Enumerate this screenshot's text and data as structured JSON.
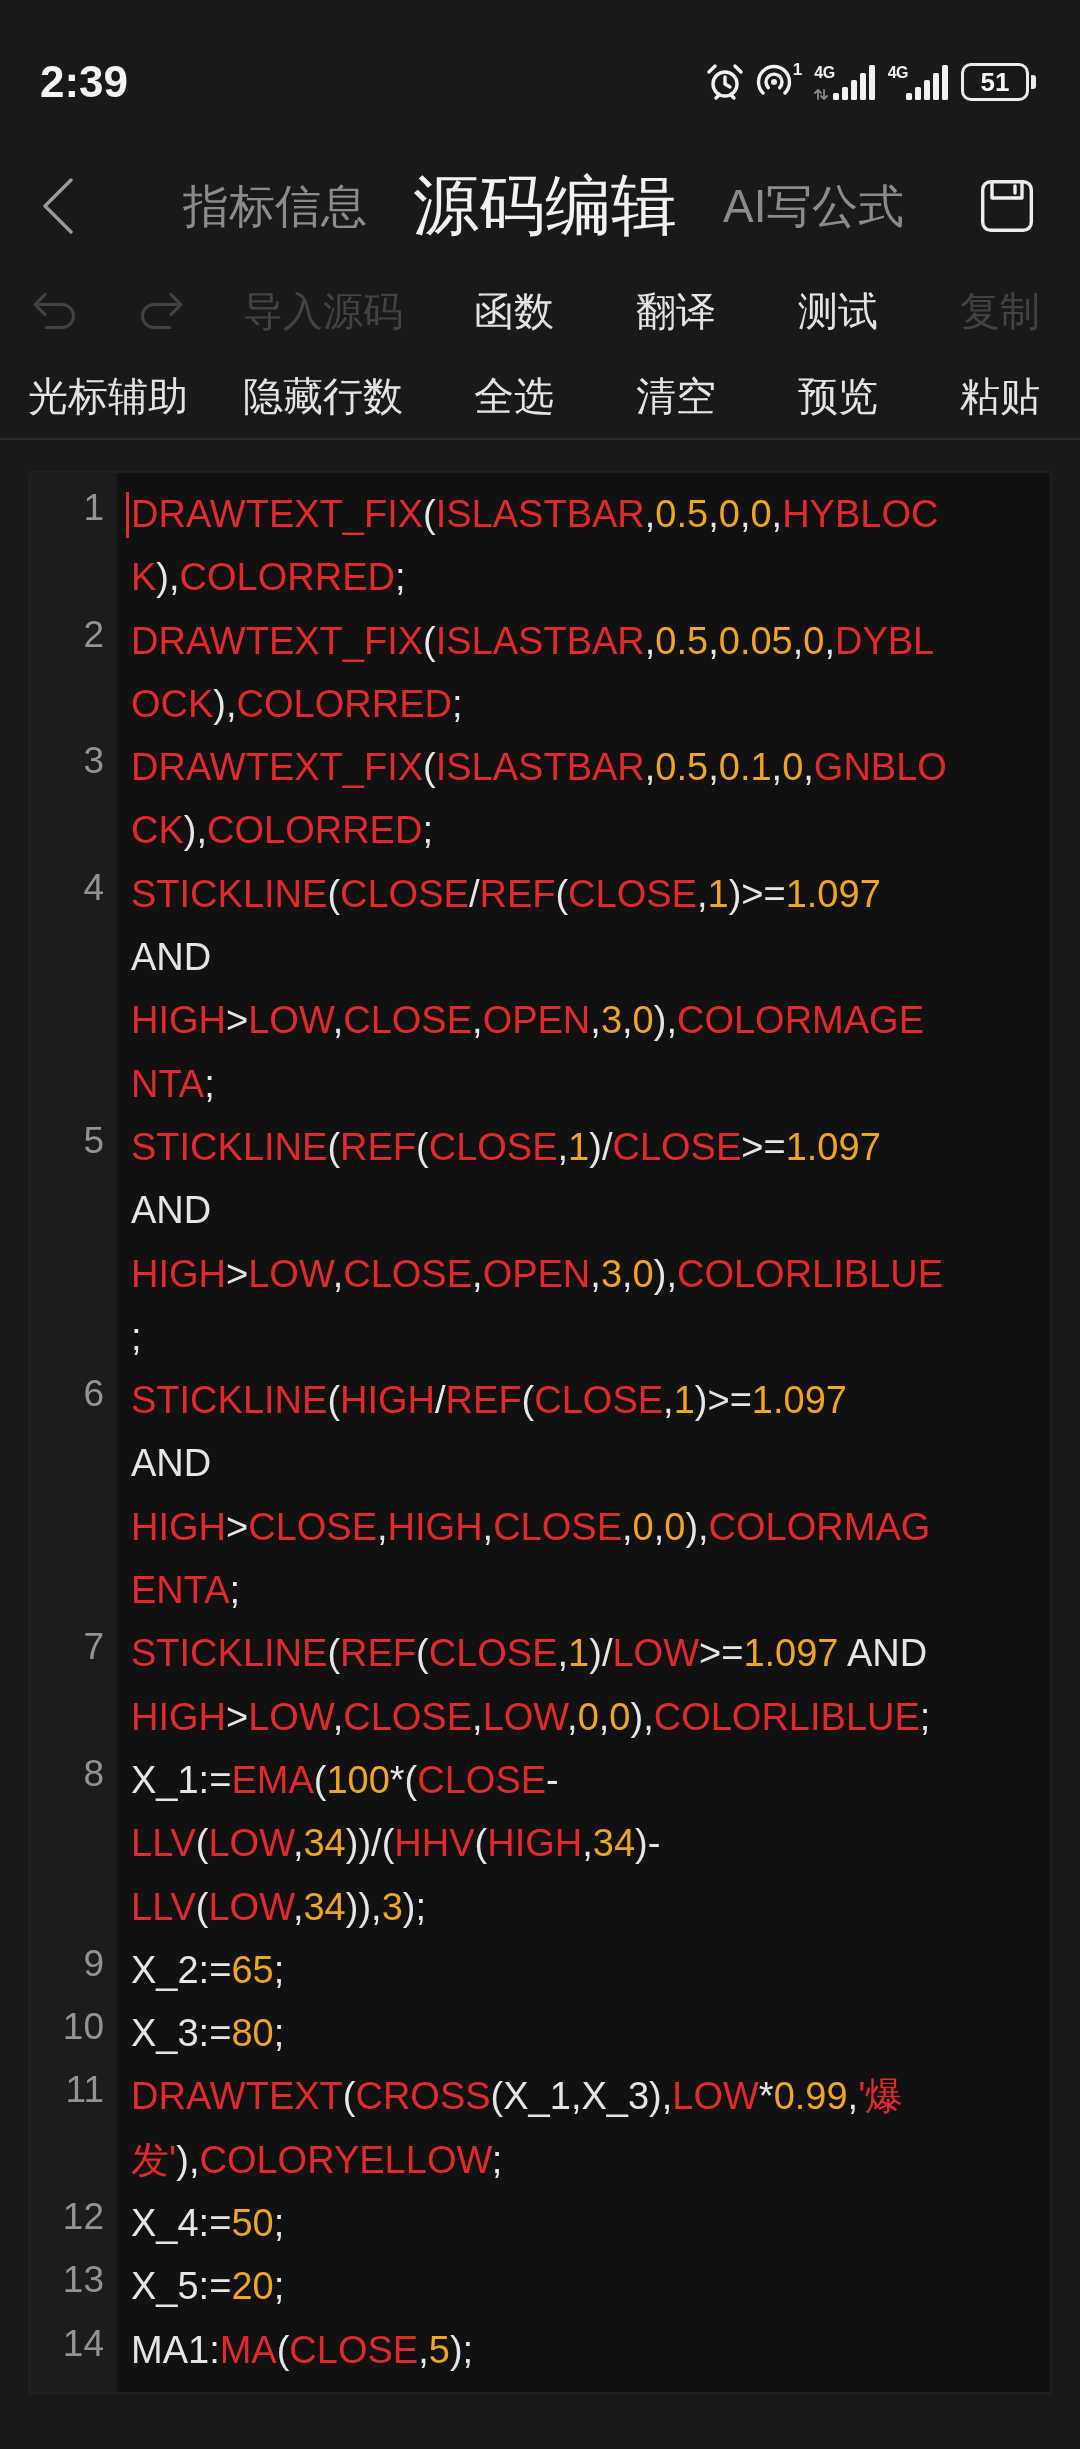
{
  "status_bar": {
    "time": "2:39",
    "hotspot_count": "1",
    "signals": [
      {
        "label": "4G",
        "data_activity": true
      },
      {
        "label": "4G",
        "data_activity": false
      }
    ],
    "battery": "51"
  },
  "header": {
    "tabs": [
      {
        "label": "指标信息",
        "selected": false
      },
      {
        "label": "源码编辑",
        "selected": true
      },
      {
        "label": "AI写公式",
        "selected": false
      }
    ]
  },
  "toolbar": {
    "rows": [
      {
        "items": [
          {
            "kind": "undo",
            "disabled": true
          },
          {
            "kind": "redo",
            "disabled": true
          },
          {
            "kind": "text",
            "label": "导入源码",
            "disabled": true
          },
          {
            "kind": "text",
            "label": "函数",
            "disabled": false
          },
          {
            "kind": "text",
            "label": "翻译",
            "disabled": false
          },
          {
            "kind": "text",
            "label": "测试",
            "disabled": false
          },
          {
            "kind": "text",
            "label": "复制",
            "disabled": true
          }
        ]
      },
      {
        "items": [
          {
            "kind": "text",
            "label": "光标辅助",
            "disabled": false
          },
          {
            "kind": "text",
            "label": "隐藏行数",
            "disabled": false
          },
          {
            "kind": "text",
            "label": "全选",
            "disabled": false
          },
          {
            "kind": "text",
            "label": "清空",
            "disabled": false
          },
          {
            "kind": "text",
            "label": "预览",
            "disabled": false
          },
          {
            "kind": "text",
            "label": "粘贴",
            "disabled": false
          }
        ]
      }
    ]
  },
  "editor": {
    "lines": [
      {
        "number": "1",
        "cursor": true,
        "wrapped_rows": [
          {
            "tokens": [
              {
                "kind": "keyword",
                "text": "DRAWTEXT_FIX"
              },
              {
                "kind": "plain",
                "text": "("
              },
              {
                "kind": "keyword",
                "text": "ISLASTBAR"
              },
              {
                "kind": "plain",
                "text": ","
              },
              {
                "kind": "number",
                "text": "0.5"
              },
              {
                "kind": "plain",
                "text": ","
              },
              {
                "kind": "number",
                "text": "0"
              },
              {
                "kind": "plain",
                "text": ","
              },
              {
                "kind": "number",
                "text": "0"
              },
              {
                "kind": "plain",
                "text": ","
              },
              {
                "kind": "keyword",
                "text": "HYBLOC"
              }
            ]
          },
          {
            "tokens": [
              {
                "kind": "keyword",
                "text": "K"
              },
              {
                "kind": "plain",
                "text": "),"
              },
              {
                "kind": "keyword",
                "text": "COLORRED"
              },
              {
                "kind": "plain",
                "text": ";"
              }
            ]
          }
        ]
      },
      {
        "number": "2",
        "cursor": false,
        "wrapped_rows": [
          {
            "tokens": [
              {
                "kind": "keyword",
                "text": "DRAWTEXT_FIX"
              },
              {
                "kind": "plain",
                "text": "("
              },
              {
                "kind": "keyword",
                "text": "ISLASTBAR"
              },
              {
                "kind": "plain",
                "text": ","
              },
              {
                "kind": "number",
                "text": "0.5"
              },
              {
                "kind": "plain",
                "text": ","
              },
              {
                "kind": "number",
                "text": "0.05"
              },
              {
                "kind": "plain",
                "text": ","
              },
              {
                "kind": "number",
                "text": "0"
              },
              {
                "kind": "plain",
                "text": ","
              },
              {
                "kind": "keyword",
                "text": "DYBL"
              }
            ]
          },
          {
            "tokens": [
              {
                "kind": "keyword",
                "text": "OCK"
              },
              {
                "kind": "plain",
                "text": "),"
              },
              {
                "kind": "keyword",
                "text": "COLORRED"
              },
              {
                "kind": "plain",
                "text": ";"
              }
            ]
          }
        ]
      },
      {
        "number": "3",
        "cursor": false,
        "wrapped_rows": [
          {
            "tokens": [
              {
                "kind": "keyword",
                "text": "DRAWTEXT_FIX"
              },
              {
                "kind": "plain",
                "text": "("
              },
              {
                "kind": "keyword",
                "text": "ISLASTBAR"
              },
              {
                "kind": "plain",
                "text": ","
              },
              {
                "kind": "number",
                "text": "0.5"
              },
              {
                "kind": "plain",
                "text": ","
              },
              {
                "kind": "number",
                "text": "0.1"
              },
              {
                "kind": "plain",
                "text": ","
              },
              {
                "kind": "number",
                "text": "0"
              },
              {
                "kind": "plain",
                "text": ","
              },
              {
                "kind": "keyword",
                "text": "GNBLO"
              }
            ]
          },
          {
            "tokens": [
              {
                "kind": "keyword",
                "text": "CK"
              },
              {
                "kind": "plain",
                "text": "),"
              },
              {
                "kind": "keyword",
                "text": "COLORRED"
              },
              {
                "kind": "plain",
                "text": ";"
              }
            ]
          }
        ]
      },
      {
        "number": "4",
        "cursor": false,
        "wrapped_rows": [
          {
            "tokens": [
              {
                "kind": "keyword",
                "text": "STICKLINE"
              },
              {
                "kind": "plain",
                "text": "("
              },
              {
                "kind": "keyword",
                "text": "CLOSE"
              },
              {
                "kind": "plain",
                "text": "/"
              },
              {
                "kind": "keyword",
                "text": "REF"
              },
              {
                "kind": "plain",
                "text": "("
              },
              {
                "kind": "keyword",
                "text": "CLOSE"
              },
              {
                "kind": "plain",
                "text": ","
              },
              {
                "kind": "number",
                "text": "1"
              },
              {
                "kind": "plain",
                "text": ")>="
              },
              {
                "kind": "number",
                "text": "1.097"
              }
            ]
          },
          {
            "tokens": [
              {
                "kind": "plain",
                "text": "AND"
              }
            ]
          },
          {
            "tokens": [
              {
                "kind": "keyword",
                "text": "HIGH"
              },
              {
                "kind": "plain",
                "text": ">"
              },
              {
                "kind": "keyword",
                "text": "LOW"
              },
              {
                "kind": "plain",
                "text": ","
              },
              {
                "kind": "keyword",
                "text": "CLOSE"
              },
              {
                "kind": "plain",
                "text": ","
              },
              {
                "kind": "keyword",
                "text": "OPEN"
              },
              {
                "kind": "plain",
                "text": ","
              },
              {
                "kind": "number",
                "text": "3"
              },
              {
                "kind": "plain",
                "text": ","
              },
              {
                "kind": "number",
                "text": "0"
              },
              {
                "kind": "plain",
                "text": "),"
              },
              {
                "kind": "keyword",
                "text": "COLORMAGE"
              }
            ]
          },
          {
            "tokens": [
              {
                "kind": "keyword",
                "text": "NTA"
              },
              {
                "kind": "plain",
                "text": ";"
              }
            ]
          }
        ]
      },
      {
        "number": "5",
        "cursor": false,
        "wrapped_rows": [
          {
            "tokens": [
              {
                "kind": "keyword",
                "text": "STICKLINE"
              },
              {
                "kind": "plain",
                "text": "("
              },
              {
                "kind": "keyword",
                "text": "REF"
              },
              {
                "kind": "plain",
                "text": "("
              },
              {
                "kind": "keyword",
                "text": "CLOSE"
              },
              {
                "kind": "plain",
                "text": ","
              },
              {
                "kind": "number",
                "text": "1"
              },
              {
                "kind": "plain",
                "text": ")/"
              },
              {
                "kind": "keyword",
                "text": "CLOSE"
              },
              {
                "kind": "plain",
                "text": ">="
              },
              {
                "kind": "number",
                "text": "1.097"
              }
            ]
          },
          {
            "tokens": [
              {
                "kind": "plain",
                "text": "AND"
              }
            ]
          },
          {
            "tokens": [
              {
                "kind": "keyword",
                "text": "HIGH"
              },
              {
                "kind": "plain",
                "text": ">"
              },
              {
                "kind": "keyword",
                "text": "LOW"
              },
              {
                "kind": "plain",
                "text": ","
              },
              {
                "kind": "keyword",
                "text": "CLOSE"
              },
              {
                "kind": "plain",
                "text": ","
              },
              {
                "kind": "keyword",
                "text": "OPEN"
              },
              {
                "kind": "plain",
                "text": ","
              },
              {
                "kind": "number",
                "text": "3"
              },
              {
                "kind": "plain",
                "text": ","
              },
              {
                "kind": "number",
                "text": "0"
              },
              {
                "kind": "plain",
                "text": "),"
              },
              {
                "kind": "keyword",
                "text": "COLORLIBLUE"
              }
            ]
          },
          {
            "tokens": [
              {
                "kind": "plain",
                "text": ";"
              }
            ]
          }
        ]
      },
      {
        "number": "6",
        "cursor": false,
        "wrapped_rows": [
          {
            "tokens": [
              {
                "kind": "keyword",
                "text": "STICKLINE"
              },
              {
                "kind": "plain",
                "text": "("
              },
              {
                "kind": "keyword",
                "text": "HIGH"
              },
              {
                "kind": "plain",
                "text": "/"
              },
              {
                "kind": "keyword",
                "text": "REF"
              },
              {
                "kind": "plain",
                "text": "("
              },
              {
                "kind": "keyword",
                "text": "CLOSE"
              },
              {
                "kind": "plain",
                "text": ","
              },
              {
                "kind": "number",
                "text": "1"
              },
              {
                "kind": "plain",
                "text": ")>="
              },
              {
                "kind": "number",
                "text": "1.097"
              }
            ]
          },
          {
            "tokens": [
              {
                "kind": "plain",
                "text": "AND"
              }
            ]
          },
          {
            "tokens": [
              {
                "kind": "keyword",
                "text": "HIGH"
              },
              {
                "kind": "plain",
                "text": ">"
              },
              {
                "kind": "keyword",
                "text": "CLOSE"
              },
              {
                "kind": "plain",
                "text": ","
              },
              {
                "kind": "keyword",
                "text": "HIGH"
              },
              {
                "kind": "plain",
                "text": ","
              },
              {
                "kind": "keyword",
                "text": "CLOSE"
              },
              {
                "kind": "plain",
                "text": ","
              },
              {
                "kind": "number",
                "text": "0"
              },
              {
                "kind": "plain",
                "text": ","
              },
              {
                "kind": "number",
                "text": "0"
              },
              {
                "kind": "plain",
                "text": "),"
              },
              {
                "kind": "keyword",
                "text": "COLORMAG"
              }
            ]
          },
          {
            "tokens": [
              {
                "kind": "keyword",
                "text": "ENTA"
              },
              {
                "kind": "plain",
                "text": ";"
              }
            ]
          }
        ]
      },
      {
        "number": "7",
        "cursor": false,
        "wrapped_rows": [
          {
            "tokens": [
              {
                "kind": "keyword",
                "text": "STICKLINE"
              },
              {
                "kind": "plain",
                "text": "("
              },
              {
                "kind": "keyword",
                "text": "REF"
              },
              {
                "kind": "plain",
                "text": "("
              },
              {
                "kind": "keyword",
                "text": "CLOSE"
              },
              {
                "kind": "plain",
                "text": ","
              },
              {
                "kind": "number",
                "text": "1"
              },
              {
                "kind": "plain",
                "text": ")/"
              },
              {
                "kind": "keyword",
                "text": "LOW"
              },
              {
                "kind": "plain",
                "text": ">="
              },
              {
                "kind": "number",
                "text": "1.097"
              },
              {
                "kind": "plain",
                "text": " AND"
              }
            ]
          },
          {
            "tokens": [
              {
                "kind": "keyword",
                "text": "HIGH"
              },
              {
                "kind": "plain",
                "text": ">"
              },
              {
                "kind": "keyword",
                "text": "LOW"
              },
              {
                "kind": "plain",
                "text": ","
              },
              {
                "kind": "keyword",
                "text": "CLOSE"
              },
              {
                "kind": "plain",
                "text": ","
              },
              {
                "kind": "keyword",
                "text": "LOW"
              },
              {
                "kind": "plain",
                "text": ","
              },
              {
                "kind": "number",
                "text": "0"
              },
              {
                "kind": "plain",
                "text": ","
              },
              {
                "kind": "number",
                "text": "0"
              },
              {
                "kind": "plain",
                "text": "),"
              },
              {
                "kind": "keyword",
                "text": "COLORLIBLUE"
              },
              {
                "kind": "plain",
                "text": ";"
              }
            ]
          }
        ]
      },
      {
        "number": "8",
        "cursor": false,
        "wrapped_rows": [
          {
            "tokens": [
              {
                "kind": "plain",
                "text": "X_1:="
              },
              {
                "kind": "keyword",
                "text": "EMA"
              },
              {
                "kind": "plain",
                "text": "("
              },
              {
                "kind": "number",
                "text": "100"
              },
              {
                "kind": "plain",
                "text": "*("
              },
              {
                "kind": "keyword",
                "text": "CLOSE"
              },
              {
                "kind": "plain",
                "text": "-"
              }
            ]
          },
          {
            "tokens": [
              {
                "kind": "keyword",
                "text": "LLV"
              },
              {
                "kind": "plain",
                "text": "("
              },
              {
                "kind": "keyword",
                "text": "LOW"
              },
              {
                "kind": "plain",
                "text": ","
              },
              {
                "kind": "number",
                "text": "34"
              },
              {
                "kind": "plain",
                "text": "))/("
              },
              {
                "kind": "keyword",
                "text": "HHV"
              },
              {
                "kind": "plain",
                "text": "("
              },
              {
                "kind": "keyword",
                "text": "HIGH"
              },
              {
                "kind": "plain",
                "text": ","
              },
              {
                "kind": "number",
                "text": "34"
              },
              {
                "kind": "plain",
                "text": ")-"
              }
            ]
          },
          {
            "tokens": [
              {
                "kind": "keyword",
                "text": "LLV"
              },
              {
                "kind": "plain",
                "text": "("
              },
              {
                "kind": "keyword",
                "text": "LOW"
              },
              {
                "kind": "plain",
                "text": ","
              },
              {
                "kind": "number",
                "text": "34"
              },
              {
                "kind": "plain",
                "text": ")),"
              },
              {
                "kind": "number",
                "text": "3"
              },
              {
                "kind": "plain",
                "text": ");"
              }
            ]
          }
        ]
      },
      {
        "number": "9",
        "cursor": false,
        "wrapped_rows": [
          {
            "tokens": [
              {
                "kind": "plain",
                "text": "X_2:="
              },
              {
                "kind": "number",
                "text": "65"
              },
              {
                "kind": "plain",
                "text": ";"
              }
            ]
          }
        ]
      },
      {
        "number": "10",
        "cursor": false,
        "wrapped_rows": [
          {
            "tokens": [
              {
                "kind": "plain",
                "text": "X_3:="
              },
              {
                "kind": "number",
                "text": "80"
              },
              {
                "kind": "plain",
                "text": ";"
              }
            ]
          }
        ]
      },
      {
        "number": "11",
        "cursor": false,
        "wrapped_rows": [
          {
            "tokens": [
              {
                "kind": "keyword",
                "text": "DRAWTEXT"
              },
              {
                "kind": "plain",
                "text": "("
              },
              {
                "kind": "keyword",
                "text": "CROSS"
              },
              {
                "kind": "plain",
                "text": "(X_1,X_3),"
              },
              {
                "kind": "keyword",
                "text": "LOW"
              },
              {
                "kind": "plain",
                "text": "*"
              },
              {
                "kind": "number",
                "text": "0.99"
              },
              {
                "kind": "plain",
                "text": ","
              },
              {
                "kind": "keyword",
                "text": "'爆"
              }
            ]
          },
          {
            "tokens": [
              {
                "kind": "keyword",
                "text": "发'"
              },
              {
                "kind": "plain",
                "text": "),"
              },
              {
                "kind": "keyword",
                "text": "COLORYELLOW"
              },
              {
                "kind": "plain",
                "text": ";"
              }
            ]
          }
        ]
      },
      {
        "number": "12",
        "cursor": false,
        "wrapped_rows": [
          {
            "tokens": [
              {
                "kind": "plain",
                "text": "X_4:="
              },
              {
                "kind": "number",
                "text": "50"
              },
              {
                "kind": "plain",
                "text": ";"
              }
            ]
          }
        ]
      },
      {
        "number": "13",
        "cursor": false,
        "wrapped_rows": [
          {
            "tokens": [
              {
                "kind": "plain",
                "text": "X_5:="
              },
              {
                "kind": "number",
                "text": "20"
              },
              {
                "kind": "plain",
                "text": ";"
              }
            ]
          }
        ]
      },
      {
        "number": "14",
        "cursor": false,
        "wrapped_rows": [
          {
            "tokens": [
              {
                "kind": "plain",
                "text": "MA1:"
              },
              {
                "kind": "keyword",
                "text": "MA"
              },
              {
                "kind": "plain",
                "text": "("
              },
              {
                "kind": "keyword",
                "text": "CLOSE"
              },
              {
                "kind": "plain",
                "text": ","
              },
              {
                "kind": "number",
                "text": "5"
              },
              {
                "kind": "plain",
                "text": ");"
              }
            ]
          }
        ]
      }
    ]
  }
}
